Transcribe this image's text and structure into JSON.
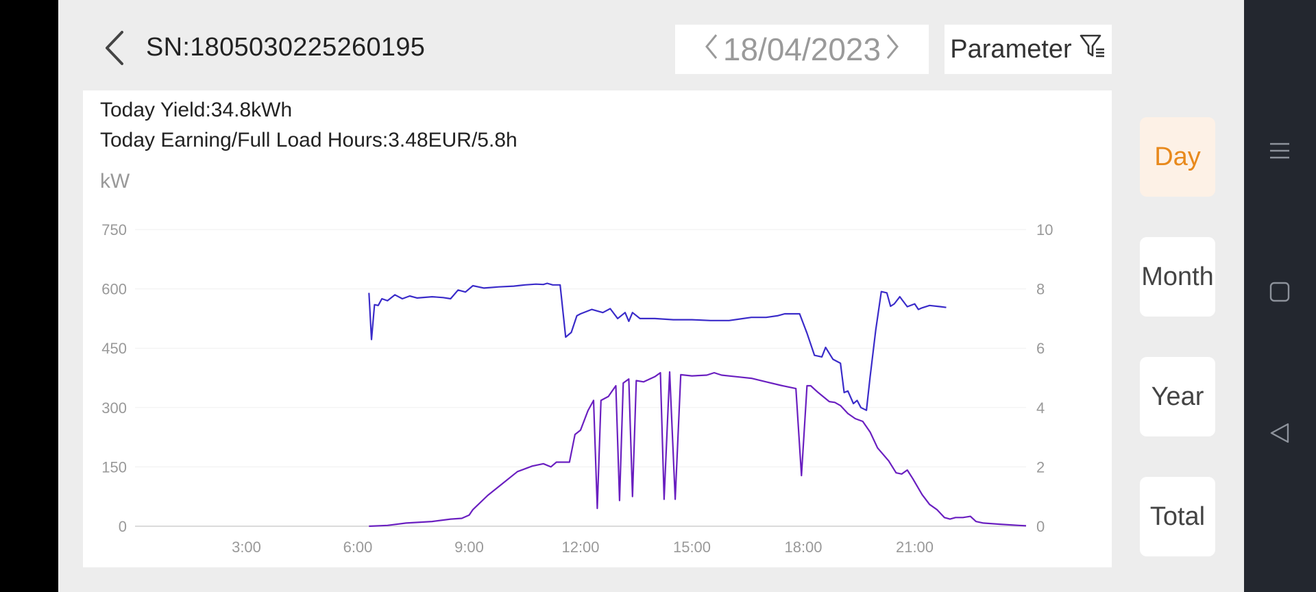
{
  "header": {
    "serial": "SN:1805030225260195",
    "date": "18/04/2023",
    "parameter_label": "Parameter"
  },
  "stats": {
    "today_yield": "Today Yield:34.8kWh",
    "today_earning": "Today Earning/Full Load Hours:3.48EUR/5.8h"
  },
  "chart_data": {
    "type": "line",
    "ylabel": "kW",
    "left_axis": {
      "ticks": [
        0,
        150,
        300,
        450,
        600,
        750
      ],
      "ylim": [
        0,
        750
      ]
    },
    "right_axis": {
      "ticks": [
        0,
        2,
        4,
        6,
        8,
        10
      ],
      "ylim": [
        0,
        10
      ]
    },
    "x_axis": {
      "ticks": [
        "3:00",
        "6:00",
        "9:00",
        "12:00",
        "15:00",
        "18:00",
        "21:00"
      ],
      "xlim_hours": [
        0,
        24
      ]
    },
    "grid": true,
    "series": [
      {
        "color": "#3a2bc9",
        "axis": "left",
        "points": [
          [
            6.3,
            590
          ],
          [
            6.37,
            472
          ],
          [
            6.45,
            560
          ],
          [
            6.55,
            558
          ],
          [
            6.65,
            575
          ],
          [
            6.8,
            570
          ],
          [
            7.0,
            585
          ],
          [
            7.2,
            575
          ],
          [
            7.4,
            582
          ],
          [
            7.6,
            577
          ],
          [
            8.0,
            580
          ],
          [
            8.3,
            578
          ],
          [
            8.5,
            575
          ],
          [
            8.7,
            597
          ],
          [
            8.9,
            592
          ],
          [
            9.1,
            608
          ],
          [
            9.4,
            602
          ],
          [
            9.8,
            605
          ],
          [
            10.2,
            607
          ],
          [
            10.5,
            610
          ],
          [
            10.8,
            612
          ],
          [
            11.0,
            611
          ],
          [
            11.1,
            614
          ],
          [
            11.25,
            610
          ],
          [
            11.45,
            610
          ],
          [
            11.6,
            478
          ],
          [
            11.75,
            490
          ],
          [
            11.9,
            532
          ],
          [
            12.0,
            537
          ],
          [
            12.3,
            548
          ],
          [
            12.6,
            540
          ],
          [
            12.8,
            550
          ],
          [
            13.0,
            525
          ],
          [
            13.2,
            540
          ],
          [
            13.3,
            518
          ],
          [
            13.4,
            540
          ],
          [
            13.6,
            525
          ],
          [
            14.0,
            525
          ],
          [
            14.5,
            522
          ],
          [
            15.0,
            522
          ],
          [
            15.5,
            520
          ],
          [
            16.0,
            520
          ],
          [
            16.3,
            524
          ],
          [
            16.6,
            528
          ],
          [
            17.0,
            528
          ],
          [
            17.3,
            532
          ],
          [
            17.5,
            537
          ],
          [
            17.9,
            537
          ],
          [
            18.1,
            488
          ],
          [
            18.3,
            432
          ],
          [
            18.5,
            428
          ],
          [
            18.6,
            452
          ],
          [
            18.8,
            422
          ],
          [
            19.0,
            412
          ],
          [
            19.1,
            338
          ],
          [
            19.2,
            342
          ],
          [
            19.35,
            310
          ],
          [
            19.45,
            318
          ],
          [
            19.55,
            300
          ],
          [
            19.7,
            293
          ],
          [
            19.8,
            378
          ],
          [
            19.95,
            495
          ],
          [
            20.1,
            593
          ],
          [
            20.25,
            590
          ],
          [
            20.35,
            556
          ],
          [
            20.45,
            562
          ],
          [
            20.6,
            580
          ],
          [
            20.8,
            555
          ],
          [
            21.0,
            562
          ],
          [
            21.1,
            548
          ],
          [
            21.2,
            552
          ],
          [
            21.4,
            558
          ],
          [
            21.7,
            555
          ],
          [
            21.85,
            553
          ]
        ]
      },
      {
        "color": "#6a1fc0",
        "axis": "left",
        "points": [
          [
            6.3,
            0
          ],
          [
            6.8,
            2
          ],
          [
            7.3,
            8
          ],
          [
            8.0,
            12
          ],
          [
            8.5,
            18
          ],
          [
            8.8,
            20
          ],
          [
            9.0,
            28
          ],
          [
            9.1,
            42
          ],
          [
            9.5,
            78
          ],
          [
            9.9,
            108
          ],
          [
            10.3,
            138
          ],
          [
            10.7,
            152
          ],
          [
            11.0,
            158
          ],
          [
            11.2,
            150
          ],
          [
            11.35,
            162
          ],
          [
            11.7,
            162
          ],
          [
            11.85,
            232
          ],
          [
            12.0,
            243
          ],
          [
            12.2,
            292
          ],
          [
            12.35,
            318
          ],
          [
            12.45,
            45
          ],
          [
            12.55,
            318
          ],
          [
            12.75,
            328
          ],
          [
            12.95,
            355
          ],
          [
            13.05,
            65
          ],
          [
            13.15,
            362
          ],
          [
            13.3,
            372
          ],
          [
            13.4,
            75
          ],
          [
            13.5,
            368
          ],
          [
            13.7,
            365
          ],
          [
            14.0,
            378
          ],
          [
            14.15,
            388
          ],
          [
            14.25,
            68
          ],
          [
            14.4,
            390
          ],
          [
            14.55,
            68
          ],
          [
            14.7,
            383
          ],
          [
            15.0,
            380
          ],
          [
            15.4,
            382
          ],
          [
            15.6,
            388
          ],
          [
            15.8,
            382
          ],
          [
            16.2,
            378
          ],
          [
            16.6,
            374
          ],
          [
            17.0,
            365
          ],
          [
            17.4,
            356
          ],
          [
            17.8,
            348
          ],
          [
            17.95,
            128
          ],
          [
            18.1,
            355
          ],
          [
            18.2,
            355
          ],
          [
            18.4,
            338
          ],
          [
            18.7,
            315
          ],
          [
            18.85,
            313
          ],
          [
            19.0,
            305
          ],
          [
            19.2,
            285
          ],
          [
            19.4,
            272
          ],
          [
            19.6,
            265
          ],
          [
            19.8,
            238
          ],
          [
            20.0,
            198
          ],
          [
            20.3,
            165
          ],
          [
            20.5,
            135
          ],
          [
            20.65,
            132
          ],
          [
            20.8,
            142
          ],
          [
            20.95,
            120
          ],
          [
            21.2,
            80
          ],
          [
            21.4,
            55
          ],
          [
            21.6,
            42
          ],
          [
            21.8,
            22
          ],
          [
            21.95,
            18
          ],
          [
            22.1,
            22
          ],
          [
            22.3,
            22
          ],
          [
            22.5,
            25
          ],
          [
            22.65,
            12
          ],
          [
            22.85,
            8
          ],
          [
            23.3,
            5
          ],
          [
            23.8,
            2
          ],
          [
            24.0,
            1
          ]
        ]
      }
    ]
  },
  "tabs": [
    "Day",
    "Month",
    "Year",
    "Total"
  ],
  "active_tab": "Day",
  "colors": {
    "accent": "#e8891c",
    "accent_bg": "#fdf1e6",
    "line_1": "#3a2bc9",
    "line_2": "#6a1fc0"
  },
  "icons": {
    "back": "chevron-left-icon",
    "date_prev": "chevron-left-icon",
    "date_next": "chevron-right-icon",
    "parameter": "filter-icon",
    "nav_menu": "menu-icon",
    "nav_home": "square-icon",
    "nav_back": "triangle-back-icon"
  }
}
